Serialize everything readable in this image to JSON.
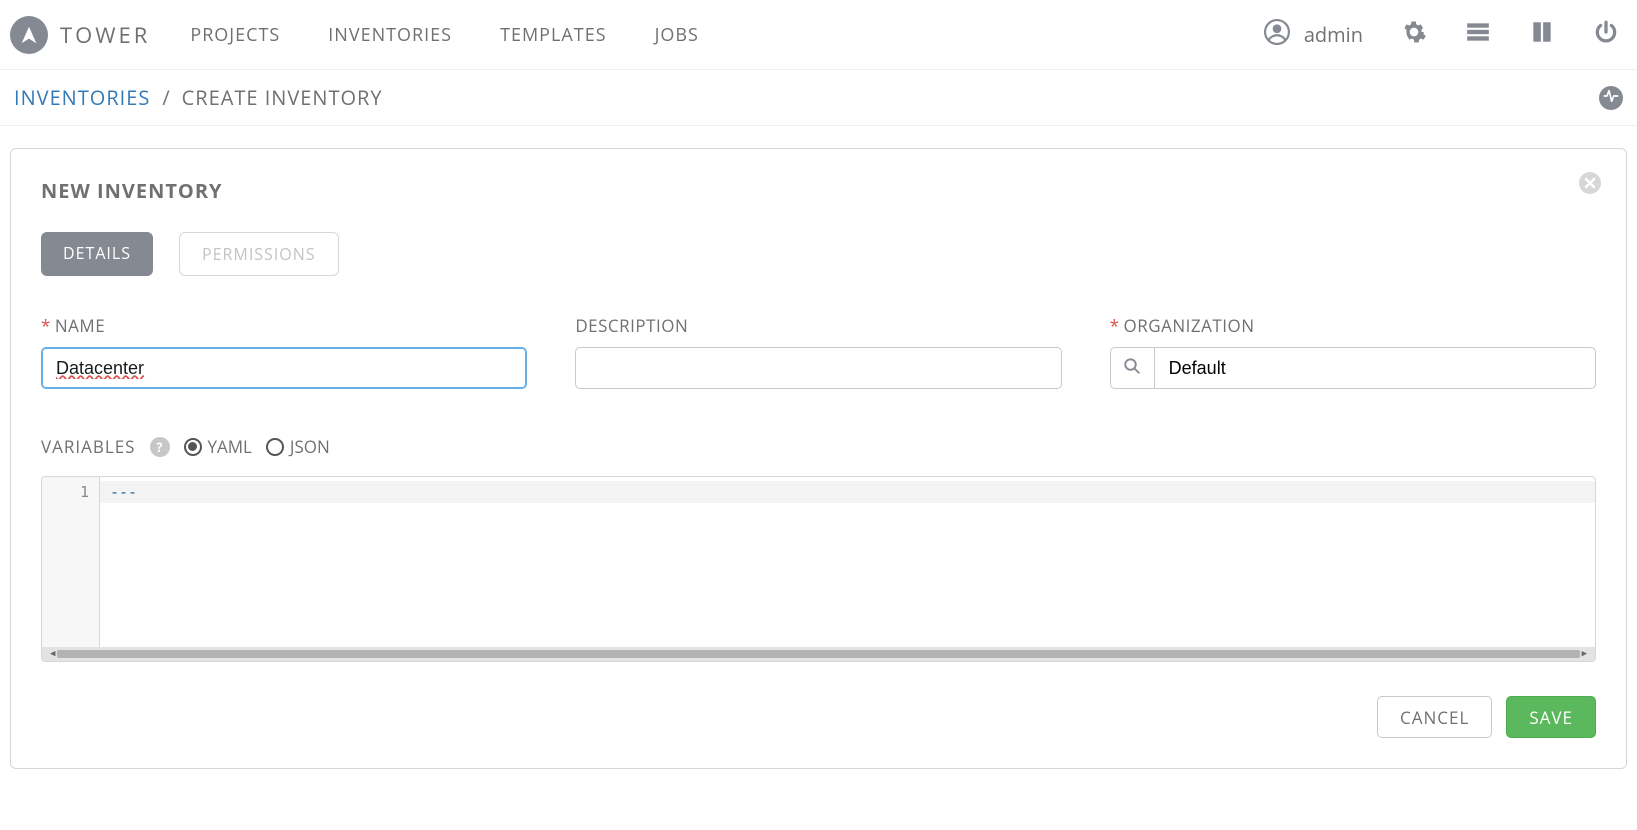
{
  "brand": {
    "name": "TOWER"
  },
  "nav": {
    "projects": "PROJECTS",
    "inventories": "INVENTORIES",
    "templates": "TEMPLATES",
    "jobs": "JOBS"
  },
  "user": {
    "name": "admin"
  },
  "breadcrumb": {
    "parent": "INVENTORIES",
    "current": "CREATE INVENTORY"
  },
  "panel": {
    "title": "NEW INVENTORY",
    "tabs": {
      "details": "DETAILS",
      "permissions": "PERMISSIONS"
    },
    "fields": {
      "name_label": "NAME",
      "name_value": "Datacenter",
      "description_label": "DESCRIPTION",
      "description_value": "",
      "organization_label": "ORGANIZATION",
      "organization_value": "Default"
    },
    "variables": {
      "label": "VARIABLES",
      "yaml": "YAML",
      "json": "JSON",
      "format_selected": "yaml",
      "line_number": "1",
      "content": "---"
    },
    "buttons": {
      "cancel": "CANCEL",
      "save": "SAVE"
    }
  }
}
